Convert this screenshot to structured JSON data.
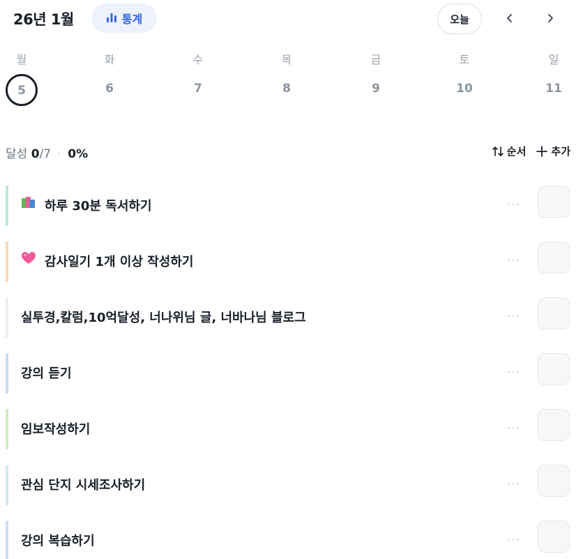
{
  "header": {
    "month_title": "26년 1월",
    "stats_label": "통계",
    "today_label": "오늘"
  },
  "week": {
    "days": [
      {
        "name": "월",
        "num": "5",
        "selected": true
      },
      {
        "name": "화",
        "num": "6",
        "selected": false
      },
      {
        "name": "수",
        "num": "7",
        "selected": false
      },
      {
        "name": "목",
        "num": "8",
        "selected": false
      },
      {
        "name": "금",
        "num": "9",
        "selected": false
      },
      {
        "name": "토",
        "num": "10",
        "selected": false
      },
      {
        "name": "일",
        "num": "11",
        "selected": false
      }
    ]
  },
  "summary": {
    "label": "달성",
    "done": "0",
    "total": "/7",
    "separator": "·",
    "percent": "0%"
  },
  "tools": {
    "sort_label": "순서",
    "add_label": "추가"
  },
  "items": [
    {
      "label": "하루 30분 독서하기",
      "icon": "books-icon",
      "bar_color": "#b7ead7"
    },
    {
      "label": "감사일기 1개 이상 작성하기",
      "icon": "heart-icon",
      "bar_color": "#fbd9b4"
    },
    {
      "label": "실투경,칼럼,10억달성, 너나위님 글, 너바나님 블로그",
      "icon": "",
      "bar_color": "#eceef1"
    },
    {
      "label": "강의 듣기",
      "icon": "",
      "bar_color": "#c9daf8"
    },
    {
      "label": "임보작성하기",
      "icon": "",
      "bar_color": "#cdeebb"
    },
    {
      "label": "관심 단지 시세조사하기",
      "icon": "",
      "bar_color": "#d3e9ef"
    },
    {
      "label": "강의 복습하기",
      "icon": "",
      "bar_color": "#cfdcf5"
    }
  ],
  "more_label": "···"
}
